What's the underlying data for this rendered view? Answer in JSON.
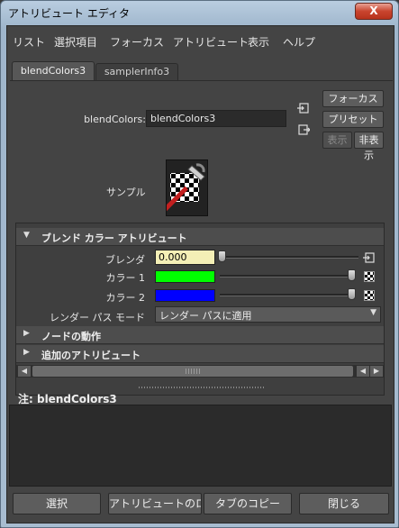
{
  "window": {
    "title": "アトリビュート エディタ",
    "close_label": "X"
  },
  "menu": [
    "リスト",
    "選択項目",
    "フォーカス",
    "アトリビュート",
    "表示",
    "ヘルプ"
  ],
  "tabs": [
    {
      "label": "blendColors3",
      "active": true
    },
    {
      "label": "samplerInfo3",
      "active": false
    }
  ],
  "node": {
    "label": "blendColors:",
    "value": "blendColors3"
  },
  "side_buttons": {
    "focus": "フォーカス",
    "preset": "プリセット",
    "show": "表示",
    "hide": "非表示"
  },
  "sample": {
    "label": "サンプル"
  },
  "sections": {
    "blend": "ブレンド カラー アトリビュート",
    "node_behavior": "ノードの動作",
    "extra": "追加のアトリビュート"
  },
  "attributes": {
    "blender": {
      "label": "ブレンダ",
      "value": "0.000",
      "slider_fraction": 0.0
    },
    "color1": {
      "label": "カラー 1",
      "color": "#00ff00"
    },
    "color2": {
      "label": "カラー 2",
      "color": "#0000ff"
    },
    "render_pass": {
      "label": "レンダー パス モード",
      "value": "レンダー パスに適用"
    }
  },
  "notes": {
    "label": "注:  blendColors3"
  },
  "bottom_buttons": {
    "select": "選択",
    "load_attrs": "アトリビュートのロード",
    "copy_tab": "タブのコピー",
    "close": "閉じる"
  }
}
